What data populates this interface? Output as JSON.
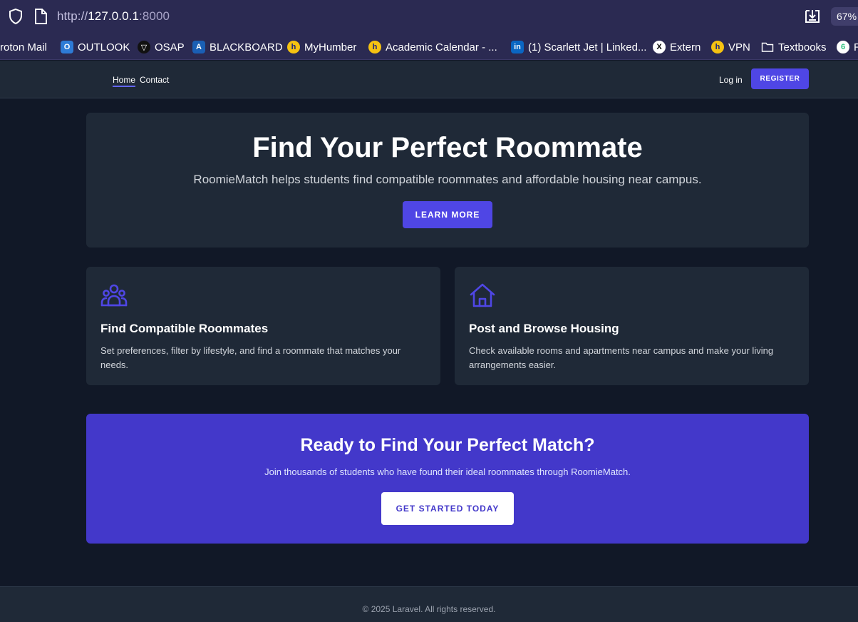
{
  "browser": {
    "url_scheme": "http://",
    "url_host": "127.0.0.1",
    "url_port": ":8000",
    "zoom": "67%",
    "bookmarks": [
      {
        "label": "roton Mail",
        "icon": "none",
        "color": ""
      },
      {
        "label": "OUTLOOK",
        "icon": "outlook-icon",
        "color": "#2e7bd6"
      },
      {
        "label": "OSAP",
        "icon": "osap-icon",
        "color": "#111111"
      },
      {
        "label": "BLACKBOARD",
        "icon": "blackboard-icon",
        "color": "#1a5fb4"
      },
      {
        "label": "MyHumber",
        "icon": "humber-icon",
        "color": "#f5c211"
      },
      {
        "label": "Academic Calendar - ...",
        "icon": "humber-icon",
        "color": "#f5c211"
      },
      {
        "label": "(1) Scarlett Jet | Linked...",
        "icon": "linkedin-icon",
        "color": "#0a66c2"
      },
      {
        "label": "Extern",
        "icon": "x-icon",
        "color": "#ffffff"
      },
      {
        "label": "VPN",
        "icon": "vpn-icon",
        "color": "#f5c211"
      },
      {
        "label": "Textbooks",
        "icon": "folder-icon",
        "color": ""
      },
      {
        "label": "R",
        "icon": "green-icon",
        "color": "#2ec27e"
      }
    ]
  },
  "nav": {
    "home": "Home",
    "contact": "Contact",
    "login": "Log in",
    "register": "REGISTER"
  },
  "hero": {
    "title": "Find Your Perfect Roommate",
    "subtitle": "RoomieMatch helps students find compatible roommates and affordable housing near campus.",
    "button": "LEARN MORE"
  },
  "features": [
    {
      "icon": "users-group-icon",
      "title": "Find Compatible Roommates",
      "description": "Set preferences, filter by lifestyle, and find a roommate that matches your needs."
    },
    {
      "icon": "home-icon",
      "title": "Post and Browse Housing",
      "description": "Check available rooms and apartments near campus and make your living arrangements easier."
    }
  ],
  "cta": {
    "title": "Ready to Find Your Perfect Match?",
    "text": "Join thousands of students who have found their ideal roommates through RoomieMatch.",
    "button": "GET STARTED TODAY"
  },
  "footer": {
    "text": "© 2025 Laravel. All rights reserved."
  },
  "colors": {
    "accent": "#4f46e5",
    "cta_bg": "#4338ca",
    "page_bg": "#111827",
    "card_bg": "#1f2937"
  }
}
